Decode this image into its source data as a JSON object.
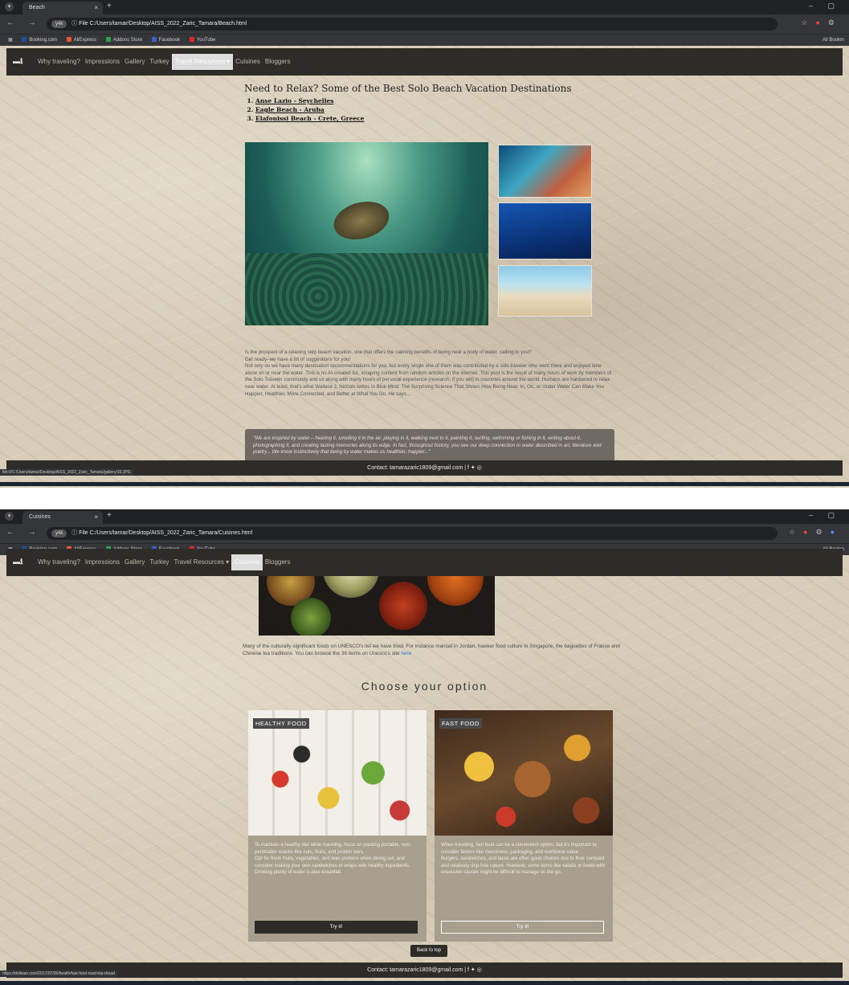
{
  "screenshot1": {
    "browser": {
      "tab_title": "Beach",
      "tab_close": "×",
      "new_tab": "+",
      "window_controls": "–  ▢",
      "nav_buttons": "← → ⟳",
      "chip_label": "y4k",
      "file_label": "ⓘ File",
      "url": "C:/Users/tamar/Desktop/AISS_2022_Zaric_Tamara/Beach.html",
      "bookmarks": [
        "Booking.com",
        "AliExpress",
        "Addons Store",
        "Facebook",
        "YouTube"
      ],
      "all_bookmarks": "All Bookm"
    },
    "nav": {
      "logo": "▬ℹ",
      "items": [
        "Why traveling?",
        "Impressions",
        "Gallery",
        "Turkey",
        "Travel Resources ▾",
        "Cuisines",
        "Bloggers"
      ],
      "active_index": 4
    },
    "heading": "Need to Relax? Some of the Best Solo Beach Vacation Destinations",
    "destinations": [
      "Anse Lazio - Seychelles",
      "Eagle Beach - Aruba",
      "Elafonissi Beach - Crete, Greece"
    ],
    "paragraph_lines": [
      "Is the prospect of a relaxing solo beach vacation, one that offers the calming benefits of being near a body of water, calling to you?",
      "Get ready–we have a lot of suggestions for you!",
      "Not only do we have many destination recommendations for you, but every single one of them was contributed by a solo traveler who went there and enjoyed time alone on or near the water. This is no AI-created list, scraping content from random articles on the internet. This post is the result of many hours of work by members of the Solo Traveler community and us along with many hours of personal experience (research, if you will) in countries around the world. Humans are hardwired to relax near water. At least, that's what Wallace J. Nichols writes in Blue Mind: The Surprising Science That Shows How Being Near, In, On, or Under Water Can Make You Happier, Healthier, More Connected, and Better at What You Do. He says..."
    ],
    "quote": "\"We are inspired by water – hearing it, smelling it in the air, playing in it, walking next to it, painting it, surfing, swimming or fishing in it, writing about it, photographing it, and creating lasting memories along its edge. In fact, throughout history, you see our deep connection to water described in art, literature and poetry... We know instinctively that being by water makes us healthier, happier...\"",
    "footer": "Contact: tamarazaric1809@gmail.com | f ✦ ◎",
    "status_link": "file:///C:/Users/tamar/Desktop/AISS_2022_Zaric_Tamara/gallery/33.JPG"
  },
  "screenshot2": {
    "browser": {
      "tab_title": "Cuisines",
      "tab_close": "×",
      "new_tab": "+",
      "window_controls": "–  ▢",
      "nav_buttons": "← → ⟳",
      "chip_label": "y4k",
      "file_label": "ⓘ File",
      "url": "C:/Users/tamar/Desktop/AISS_2022_Zaric_Tamara/Cuisines.html",
      "bookmarks": [
        "Booking.com",
        "AliExpress",
        "Addons Store",
        "Facebook",
        "YouTube"
      ],
      "all_bookmarks": "All Bookm"
    },
    "nav": {
      "logo": "▬ℹ",
      "items": [
        "Why traveling?",
        "Impressions",
        "Gallery",
        "Turkey",
        "Travel Resources ▾",
        "Cuisines",
        "Bloggers"
      ],
      "active_index": 5
    },
    "intro_before_link": "Many of the culturally significant foods on UNESCO's list we have tried. For instance mansaf in Jordan, hawker food culture in Singapore, the baguettes of France and Chinese tea traditions. You can browse the 36 items on Unesco's site ",
    "intro_link": "here",
    "choose_heading": "Choose your option",
    "cards": [
      {
        "badge": "HEALTHY FOOD",
        "text": "To maintain a healthy diet while traveling, focus on packing portable, non-perishable snacks like nuts, fruits, and protein bars.\nOpt for fresh fruits, vegetables, and lean proteins when dining out, and consider making your own sandwiches or wraps with healthy ingredients.\nDrinking plenty of water is also essential.",
        "button": "Try it!"
      },
      {
        "badge": "FAST FOOD",
        "text": "When traveling, fast food can be a convenient option, but it's important to consider factors like messiness, packaging, and nutritional value.\nBurgers, sandwiches, and tacos are often good choices due to their compact and relatively drip-free nature. However, some items like salads or foods with excessive sauces might be difficult to manage on the go.",
        "button": "Try it!"
      }
    ],
    "back_to_top": "Back to top",
    "footer": "Contact: tamarazaric1809@gmail.com | f ✦ ◎",
    "status_link": "https://dollisan.com/2017/07/26/health/fast-food-road-trip-dread"
  }
}
